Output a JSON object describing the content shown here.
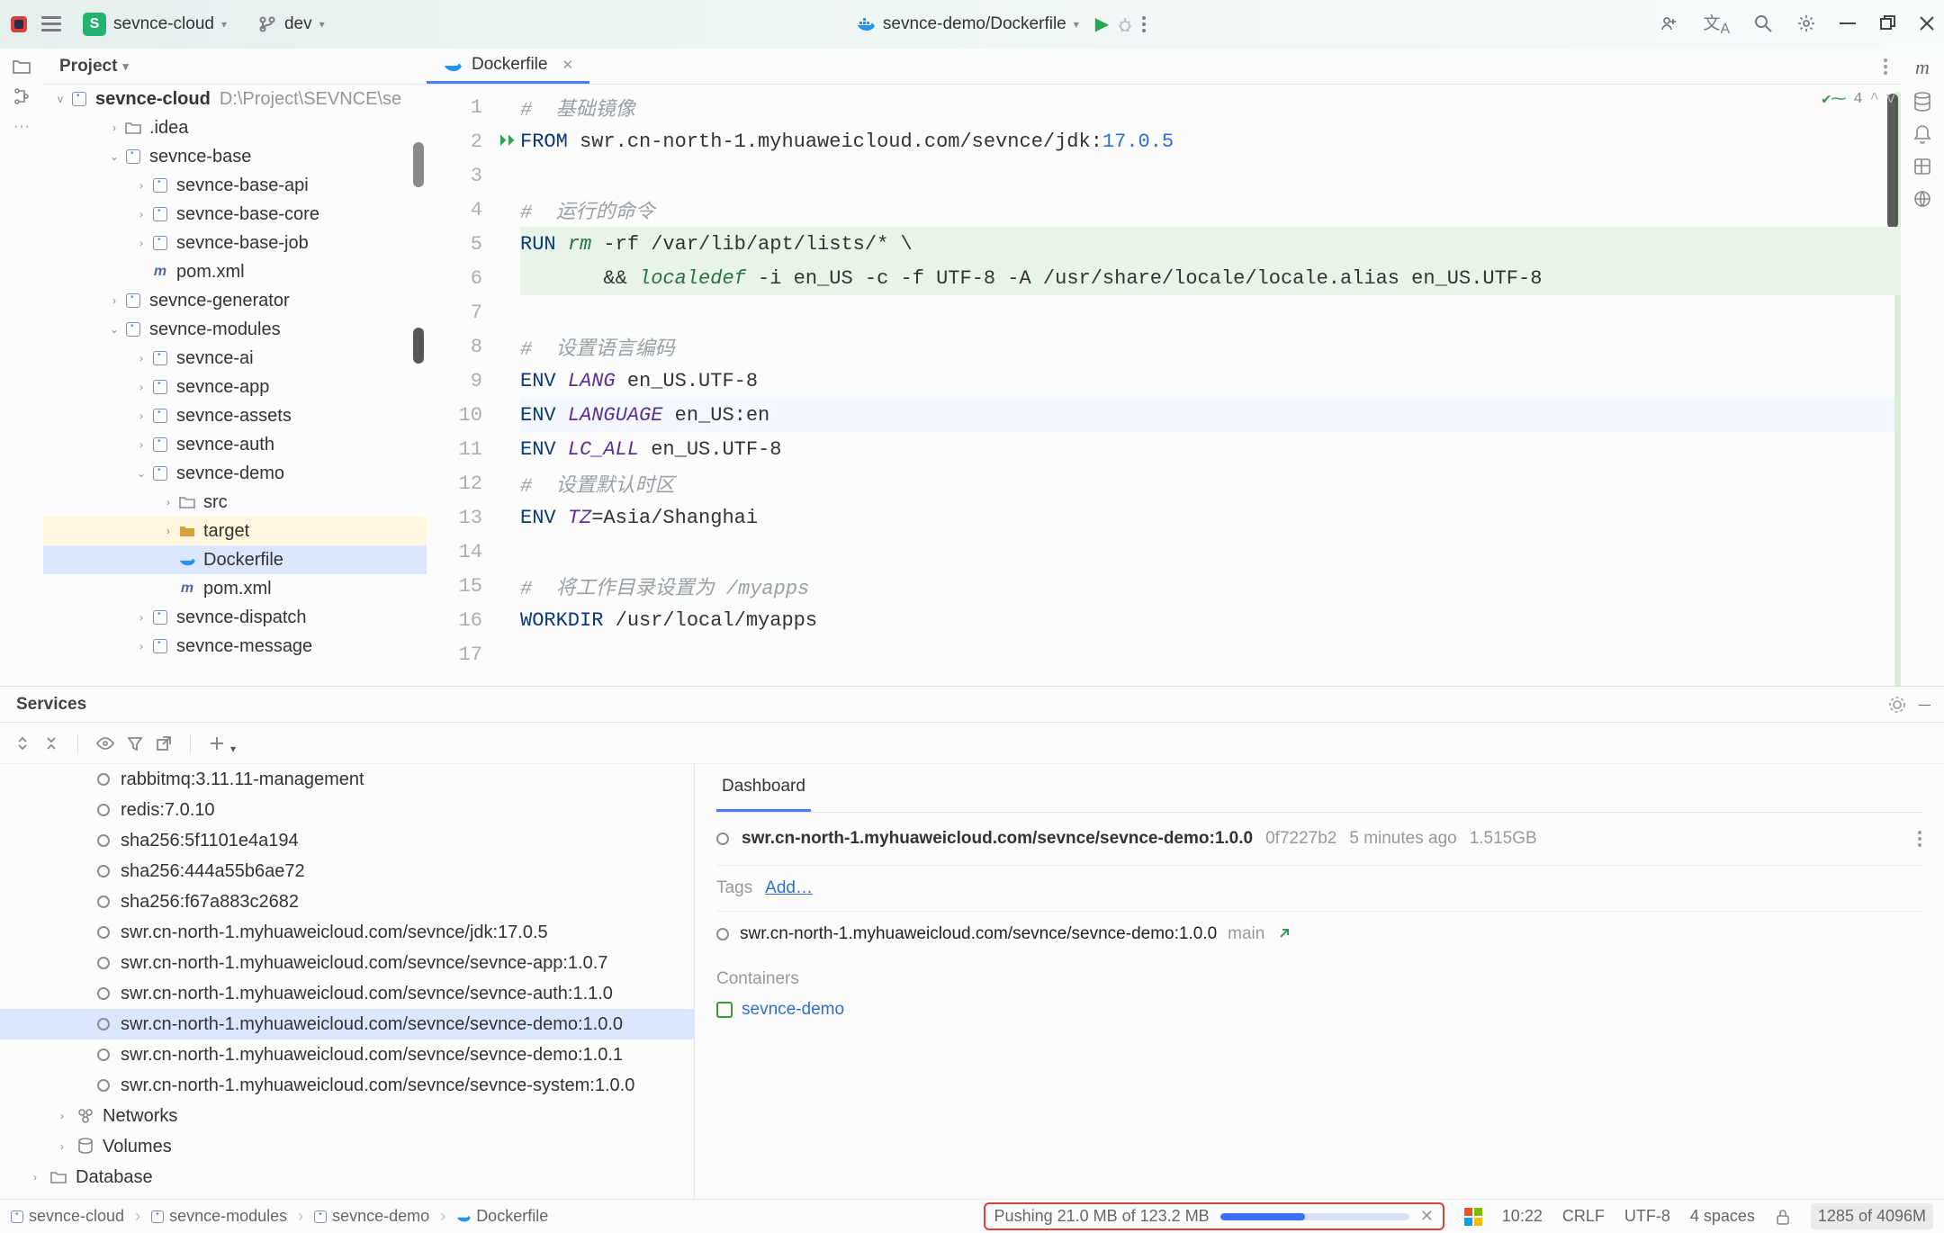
{
  "topbar": {
    "project_label": "sevnce-cloud",
    "branch_label": "dev",
    "run_config": "sevnce-demo/Dockerfile"
  },
  "project_panel": {
    "title": "Project",
    "root_name": "sevnce-cloud",
    "root_path": "D:\\Project\\SEVNCE\\se",
    "nodes": [
      {
        "indent": 2,
        "tw": ">",
        "iconType": "folder",
        "label": ".idea"
      },
      {
        "indent": 2,
        "tw": "v",
        "iconType": "module",
        "label": "sevnce-base"
      },
      {
        "indent": 3,
        "tw": ">",
        "iconType": "module",
        "label": "sevnce-base-api"
      },
      {
        "indent": 3,
        "tw": ">",
        "iconType": "module",
        "label": "sevnce-base-core"
      },
      {
        "indent": 3,
        "tw": ">",
        "iconType": "module",
        "label": "sevnce-base-job"
      },
      {
        "indent": 3,
        "tw": "",
        "iconType": "m",
        "label": "pom.xml"
      },
      {
        "indent": 2,
        "tw": ">",
        "iconType": "module",
        "label": "sevnce-generator"
      },
      {
        "indent": 2,
        "tw": "v",
        "iconType": "module",
        "label": "sevnce-modules"
      },
      {
        "indent": 3,
        "tw": ">",
        "iconType": "module",
        "label": "sevnce-ai"
      },
      {
        "indent": 3,
        "tw": ">",
        "iconType": "module",
        "label": "sevnce-app"
      },
      {
        "indent": 3,
        "tw": ">",
        "iconType": "module",
        "label": "sevnce-assets"
      },
      {
        "indent": 3,
        "tw": ">",
        "iconType": "module",
        "label": "sevnce-auth"
      },
      {
        "indent": 3,
        "tw": "v",
        "iconType": "module",
        "label": "sevnce-demo"
      },
      {
        "indent": 4,
        "tw": ">",
        "iconType": "folder",
        "label": "src"
      },
      {
        "indent": 4,
        "tw": ">",
        "iconType": "folder-y",
        "label": "target",
        "selected": "yellow"
      },
      {
        "indent": 4,
        "tw": "",
        "iconType": "docker",
        "label": "Dockerfile",
        "selected": "blue"
      },
      {
        "indent": 4,
        "tw": "",
        "iconType": "m",
        "label": "pom.xml"
      },
      {
        "indent": 3,
        "tw": ">",
        "iconType": "module",
        "label": "sevnce-dispatch"
      },
      {
        "indent": 3,
        "tw": ">",
        "iconType": "module",
        "label": "sevnce-message"
      }
    ]
  },
  "editor": {
    "tab_name": "Dockerfile",
    "inspect_count": "4",
    "lines": [
      {
        "n": 1,
        "segs": [
          {
            "t": "#  基础镜像",
            "cls": "cmt"
          }
        ]
      },
      {
        "n": 2,
        "segs": [
          {
            "t": "FROM",
            "cls": "kw"
          },
          {
            "t": " swr.cn-north-1.myhuaweicloud.com/sevnce/jdk:",
            "cls": "pipe"
          },
          {
            "t": "17.0.5",
            "cls": "num"
          }
        ],
        "run": true
      },
      {
        "n": 3,
        "segs": []
      },
      {
        "n": 4,
        "segs": [
          {
            "t": "#  运行的命令",
            "cls": "cmt"
          }
        ]
      },
      {
        "n": 5,
        "segs": [
          {
            "t": "RUN",
            "cls": "kw"
          },
          {
            "t": " ",
            "cls": "pipe"
          },
          {
            "t": "rm",
            "cls": "cmd"
          },
          {
            "t": " -rf /var/lib/apt/lists/* \\",
            "cls": "pipe"
          }
        ],
        "bg": "green"
      },
      {
        "n": 6,
        "segs": [
          {
            "t": "       && ",
            "cls": "pipe"
          },
          {
            "t": "localedef",
            "cls": "cmd"
          },
          {
            "t": " -i en_US -c -f UTF-8 -A /usr/share/locale/locale.alias en_US.UTF-8",
            "cls": "pipe"
          }
        ],
        "bg": "green"
      },
      {
        "n": 7,
        "segs": []
      },
      {
        "n": 8,
        "segs": [
          {
            "t": "#  设置语言编码",
            "cls": "cmt"
          }
        ]
      },
      {
        "n": 9,
        "segs": [
          {
            "t": "ENV",
            "cls": "kw"
          },
          {
            "t": " ",
            "cls": "pipe"
          },
          {
            "t": "LANG",
            "cls": "tag"
          },
          {
            "t": " en_US.UTF-8",
            "cls": "pipe"
          }
        ]
      },
      {
        "n": 10,
        "segs": [
          {
            "t": "ENV",
            "cls": "kw"
          },
          {
            "t": " ",
            "cls": "pipe"
          },
          {
            "t": "LANGUAGE",
            "cls": "tag"
          },
          {
            "t": " en_US:en",
            "cls": "pipe"
          }
        ],
        "hl": true
      },
      {
        "n": 11,
        "segs": [
          {
            "t": "ENV",
            "cls": "kw"
          },
          {
            "t": " ",
            "cls": "pipe"
          },
          {
            "t": "LC_ALL",
            "cls": "tag"
          },
          {
            "t": " en_US.UTF-8",
            "cls": "pipe"
          }
        ]
      },
      {
        "n": 12,
        "segs": [
          {
            "t": "#  设置默认时区",
            "cls": "cmt"
          }
        ]
      },
      {
        "n": 13,
        "segs": [
          {
            "t": "ENV",
            "cls": "kw"
          },
          {
            "t": " ",
            "cls": "pipe"
          },
          {
            "t": "TZ",
            "cls": "tag"
          },
          {
            "t": "=Asia/Shanghai",
            "cls": "pipe"
          }
        ]
      },
      {
        "n": 14,
        "segs": []
      },
      {
        "n": 15,
        "segs": [
          {
            "t": "#  将工作目录设置为 /myapps",
            "cls": "cmt"
          }
        ]
      },
      {
        "n": 16,
        "segs": [
          {
            "t": "WORKDIR",
            "cls": "kw"
          },
          {
            "t": " /usr/local/myapps",
            "cls": "pipe"
          }
        ]
      },
      {
        "n": 17,
        "segs": []
      }
    ]
  },
  "services": {
    "title": "Services",
    "dashboard_label": "Dashboard",
    "image_name": "swr.cn-north-1.myhuaweicloud.com/sevnce/sevnce-demo:1.0.0",
    "image_hash": "0f7227b2",
    "image_age": "5 minutes ago",
    "image_size": "1.515GB",
    "tags_label": "Tags",
    "add_label": "Add…",
    "image2": "swr.cn-north-1.myhuaweicloud.com/sevnce/sevnce-demo:1.0.0",
    "image2_ext": "main",
    "containers_label": "Containers",
    "container_name": "sevnce-demo",
    "list": [
      "rabbitmq:3.11.11-management",
      "redis:7.0.10",
      "sha256:5f1101e4a194",
      "sha256:444a55b6ae72",
      "sha256:f67a883c2682",
      "swr.cn-north-1.myhuaweicloud.com/sevnce/jdk:17.0.5",
      "swr.cn-north-1.myhuaweicloud.com/sevnce/sevnce-app:1.0.7",
      "swr.cn-north-1.myhuaweicloud.com/sevnce/sevnce-auth:1.1.0",
      "swr.cn-north-1.myhuaweicloud.com/sevnce/sevnce-demo:1.0.0",
      "swr.cn-north-1.myhuaweicloud.com/sevnce/sevnce-demo:1.0.1",
      "swr.cn-north-1.myhuaweicloud.com/sevnce/sevnce-system:1.0.0"
    ],
    "networks": "Networks",
    "volumes": "Volumes",
    "database": "Database"
  },
  "status": {
    "crumbs": [
      "sevnce-cloud",
      "sevnce-modules",
      "sevnce-demo",
      "Dockerfile"
    ],
    "push_text": "Pushing 21.0 MB of 123.2 MB",
    "time": "10:22",
    "line_ending": "CRLF",
    "encoding": "UTF-8",
    "indent": "4 spaces",
    "memory": "1285 of 4096M"
  }
}
